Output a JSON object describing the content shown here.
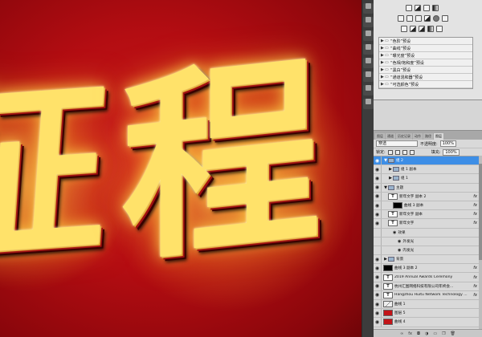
{
  "canvas": {
    "text_main": "程",
    "text_left": "征"
  },
  "rail": {
    "buttons": [
      "tools-icon",
      "color-icon",
      "adjust-icon",
      "history-icon",
      "info-icon",
      "paragraph-icon",
      "char-icon",
      "path-icon"
    ]
  },
  "adjustments": {
    "presets": [
      "“色阶”预设",
      "“曲线”预设",
      "“曝光度”预设",
      "“色相/饱和度”预设",
      "“黑白”预设",
      "“通道混和器”预设",
      "“可选颜色”预设"
    ]
  },
  "layers_panel": {
    "tabs": [
      "图层",
      "通道",
      "历史记录",
      "动作",
      "路径",
      "图层"
    ],
    "blend_mode": "穿透",
    "opacity_label": "不透明度:",
    "opacity_value": "100%",
    "lock_label": "锁定:",
    "fill_label": "填充:",
    "fill_value": "100%",
    "layers": [
      {
        "name": "组 2",
        "kind": "group",
        "indent": 0,
        "selected": true,
        "expanded": true
      },
      {
        "name": "组 1 副本",
        "kind": "group",
        "indent": 1
      },
      {
        "name": "组 1",
        "kind": "group",
        "indent": 1
      },
      {
        "name": "主题",
        "kind": "group",
        "indent": 0,
        "expanded": true
      },
      {
        "name": "新年文字 副本 2",
        "kind": "text",
        "indent": 1,
        "fx": true
      },
      {
        "name": "曲线 3 副本",
        "kind": "curve-black",
        "indent": 2,
        "fx": true
      },
      {
        "name": "新年文字 副本",
        "kind": "text",
        "indent": 1,
        "fx": true
      },
      {
        "name": "新年文字",
        "kind": "text",
        "indent": 1,
        "fx": true
      },
      {
        "name": "效果",
        "kind": "effects",
        "indent": 2
      },
      {
        "name": "外发光",
        "kind": "effect",
        "indent": 3
      },
      {
        "name": "内发光",
        "kind": "effect",
        "indent": 3
      },
      {
        "name": "背景",
        "kind": "group",
        "indent": 0
      },
      {
        "name": "曲线 3 副本 2",
        "kind": "curve-black",
        "indent": 0,
        "fx": true
      },
      {
        "name": "2019 Annual Awards Ceremony",
        "kind": "text",
        "indent": 0,
        "fx": true
      },
      {
        "name": "杭州汇图网络科技有限公司年终会...",
        "kind": "text",
        "indent": 0,
        "fx": true
      },
      {
        "name": "Hangzhou Huitu Network Technology ...",
        "kind": "text",
        "indent": 0,
        "fx": true
      },
      {
        "name": "曲线 1",
        "kind": "curve",
        "indent": 0
      },
      {
        "name": "图层 5",
        "kind": "red",
        "indent": 0
      },
      {
        "name": "曲线 4",
        "kind": "red",
        "indent": 0
      }
    ],
    "bottom_icons": [
      "link-icon",
      "fx-icon",
      "mask-icon",
      "adjustment-icon",
      "folder-icon",
      "new-layer-icon",
      "trash-icon"
    ]
  }
}
